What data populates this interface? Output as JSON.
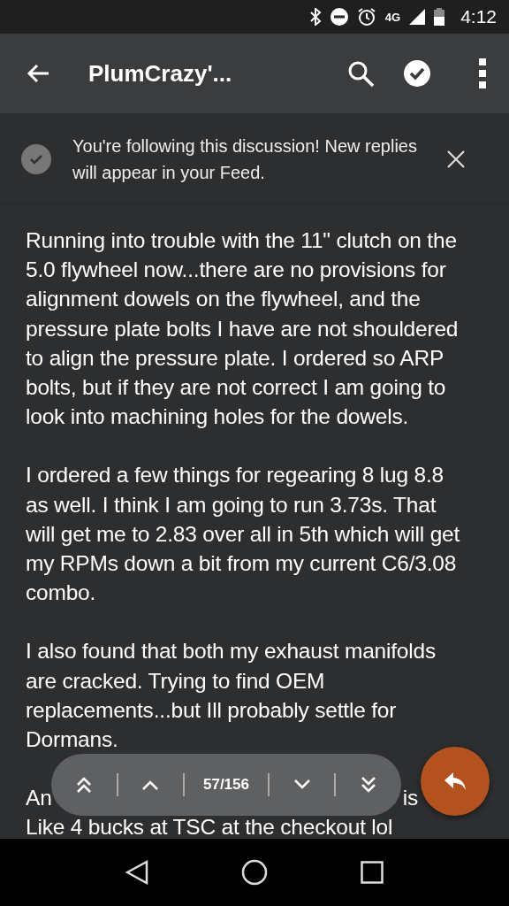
{
  "status_bar": {
    "network": "4G",
    "time": "4:12"
  },
  "app_bar": {
    "title": "PlumCrazy'..."
  },
  "banner": {
    "text": "You're following this discussion! New replies will appear in your Feed.",
    "checked": true
  },
  "post": {
    "paragraphs": [
      "Running into trouble with the 11\" clutch on the 5.0 flywheel now...there are no provisions for alignment dowels on the flywheel, and the pressure plate bolts I have are not shouldered to align the pressure plate. I ordered so ARP bolts, but if they are not correct I am going to look into machining holes for the dowels.",
      "I ordered a few things for regearing 8 lug 8.8 as well. I think I am going to run 3.73s. That will get me to 2.83 over all in 5th which will get my RPMs down a bit from my current C6/3.08 combo.",
      "I also found that both my exhaust manifolds are cracked. Trying to find OEM replacements...but Ill probably settle for Dormans."
    ],
    "partial_left": "An",
    "partial_right": "is",
    "last_line": "Like 4 bucks at TSC at the checkout lol"
  },
  "pager": {
    "position": "57/156"
  }
}
